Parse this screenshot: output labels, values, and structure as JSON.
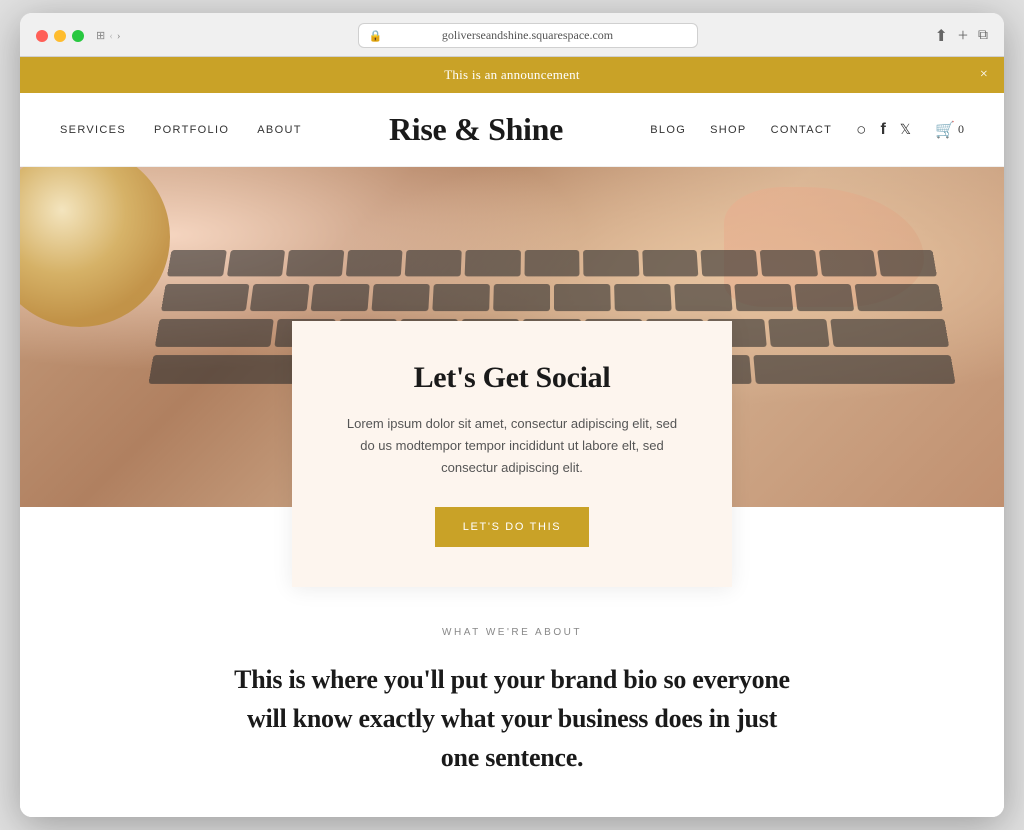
{
  "browser": {
    "url": "goliverseandshine.squarespace.com",
    "reload_label": "↻"
  },
  "announcement": {
    "text": "This is an announcement",
    "close_label": "×"
  },
  "nav": {
    "logo": "Rise & Shine",
    "left_links": [
      {
        "label": "SERVICES",
        "id": "services"
      },
      {
        "label": "PORTFOLIO",
        "id": "portfolio"
      },
      {
        "label": "ABOUT",
        "id": "about"
      }
    ],
    "right_links": [
      {
        "label": "BLOG",
        "id": "blog"
      },
      {
        "label": "SHOP",
        "id": "shop"
      },
      {
        "label": "CONTACT",
        "id": "contact"
      }
    ],
    "cart_count": "0"
  },
  "hero_card": {
    "title": "Let's Get Social",
    "body": "Lorem ipsum dolor sit amet, consectur adipiscing elit, sed do us modtempor tempor incididunt ut labore elt, sed consectur adipiscing elit.",
    "button_label": "LET'S DO THIS"
  },
  "about_section": {
    "eyebrow": "WHAT WE'RE ABOUT",
    "headline": "This is where you'll put your brand bio so everyone will know exactly what your business does in just one sentence."
  }
}
